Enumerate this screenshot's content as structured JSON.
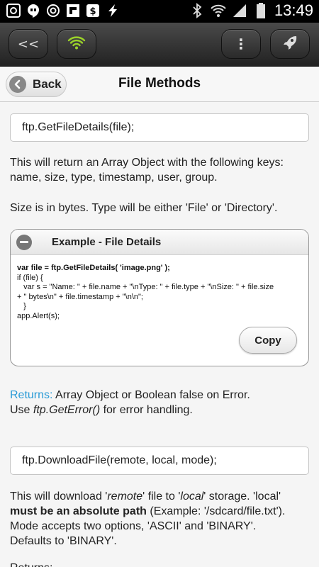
{
  "status_bar": {
    "time": "13:49",
    "left_icons": [
      "pocket-icon",
      "hangouts-icon",
      "sync-icon",
      "flipboard-icon",
      "square-s-icon",
      "bolt-icon"
    ],
    "right_icons": [
      "bluetooth-icon",
      "wifi-icon",
      "signal-icon",
      "battery-icon"
    ]
  },
  "toolbar": {
    "back_label": "<<",
    "menu_label": "⋮"
  },
  "header": {
    "back_label": "Back",
    "title": "File Methods"
  },
  "content": {
    "method1": "ftp.GetFileDetails(file);",
    "desc1_line1": "This will return an Array Object with the following keys:",
    "desc1_line2": "name, size, type, timestamp, user, group.",
    "desc2": "Size is in bytes. Type will be either 'File' or 'Directory'.",
    "example": {
      "title": "Example - File Details",
      "code_line1": "var file = ftp.GetFileDetails( 'image.png' );",
      "code_rest": "if (file) {\n   var s = \"Name: \" + file.name + \"\\nType: \" + file.type + \"\\nSize: \" + file.size\n+ \" bytes\\n\" + file.timestamp + \"\\n\\n\";\n   }\napp.Alert(s);",
      "copy_label": "Copy"
    },
    "returns_label": "Returns:",
    "returns_text": " Array Object or Boolean false on Error.",
    "use_text": "Use ",
    "use_method": "ftp.GetError()",
    "use_suffix": " for error handling.",
    "method2": "ftp.DownloadFile(remote, local, mode);",
    "download": {
      "p1": "This will download '",
      "remote": "remote",
      "p2": "' file to '",
      "local": "local",
      "p3": "' storage. 'local'",
      "bold": "must be an absolute path",
      "p4": " (Example: '/sdcard/file.txt').",
      "p5": "Mode accepts two options, 'ASCII' and 'BINARY'.",
      "p6": "Defaults to 'BINARY'."
    },
    "partial_text": "Returns: ..."
  }
}
